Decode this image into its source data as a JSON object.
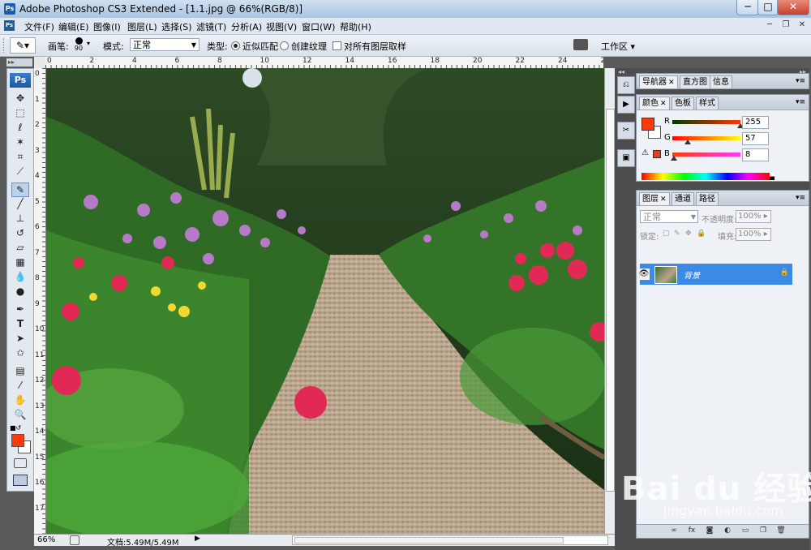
{
  "window": {
    "app_icon": "Ps",
    "title": "Adobe Photoshop CS3 Extended - [1.1.jpg @ 66%(RGB/8)]",
    "minimize": "─",
    "maximize": "□",
    "close": "✕"
  },
  "menu": {
    "ps_icon": "Ps",
    "items": [
      "文件(F)",
      "编辑(E)",
      "图像(I)",
      "图层(L)",
      "选择(S)",
      "滤镜(T)",
      "分析(A)",
      "视图(V)",
      "窗口(W)",
      "帮助(H)"
    ],
    "doc_minimize": "─",
    "doc_restore": "❐",
    "doc_close": "✕"
  },
  "options": {
    "brush_label": "画笔:",
    "brush_size": "90",
    "mode_label": "模式:",
    "mode_value": "正常",
    "type_label": "类型:",
    "type_option1": "近似匹配",
    "type_option2": "创建纹理",
    "sample_all_layers": "对所有图层取样",
    "workspace": "工作区"
  },
  "ruler": {
    "top": [
      "0",
      "2",
      "4",
      "6",
      "8",
      "10",
      "12",
      "14",
      "16",
      "18",
      "20",
      "22",
      "24",
      "26"
    ],
    "left": [
      "0",
      "1",
      "2",
      "3",
      "4",
      "5",
      "6",
      "7",
      "8",
      "9",
      "10",
      "11",
      "12",
      "13",
      "14",
      "15",
      "16",
      "17"
    ]
  },
  "tools": {
    "logo": "Ps",
    "items": [
      "move-tool",
      "marquee-tool",
      "lasso-tool",
      "magic-wand-tool",
      "crop-tool",
      "slice-tool",
      "spot-healing-tool",
      "brush-tool",
      "clone-stamp-tool",
      "history-brush-tool",
      "eraser-tool",
      "gradient-tool",
      "blur-tool",
      "dodge-tool",
      "pen-tool",
      "type-tool",
      "path-selection-tool",
      "shape-tool",
      "notes-tool",
      "eyedropper-tool",
      "hand-tool",
      "zoom-tool"
    ],
    "foreground_color": "#ff3908",
    "background_color": "#ffffff"
  },
  "status": {
    "zoom": "66%",
    "doc_info": "文档:5.49M/5.49M"
  },
  "navigator_panel": {
    "tabs": [
      "导航器",
      "直方图",
      "信息"
    ]
  },
  "color_panel": {
    "tabs": [
      "颜色",
      "色板",
      "样式"
    ],
    "r_label": "R",
    "g_label": "G",
    "b_label": "B",
    "r_value": "255",
    "g_value": "57",
    "b_value": "8",
    "swatch_color": "#ff3908"
  },
  "layers_panel": {
    "tabs": [
      "图层",
      "通道",
      "路径"
    ],
    "blend_mode": "正常",
    "opacity_label": "不透明度:",
    "opacity_value": "100%",
    "lock_label": "锁定:",
    "fill_label": "填充:",
    "fill_value": "100%",
    "layer_name": "背景"
  },
  "watermark": {
    "brand": "Bai du 经验",
    "url": "jingyan.baidu.com"
  }
}
